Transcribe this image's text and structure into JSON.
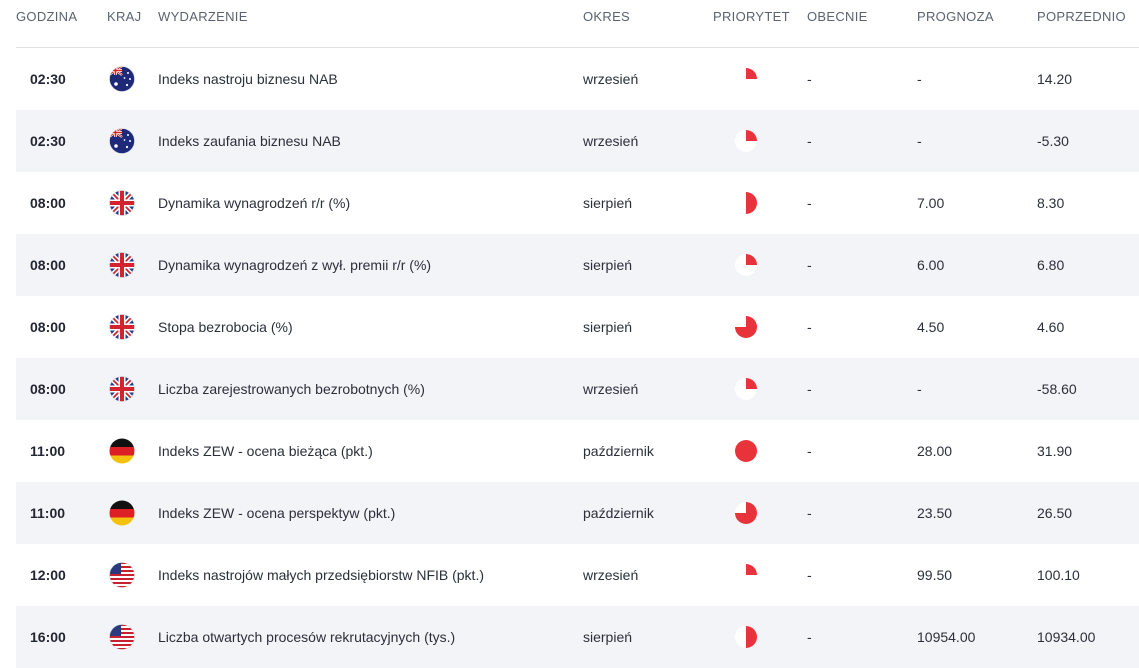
{
  "header": {
    "time": "GODZINA",
    "country": "KRAJ",
    "event": "WYDARZENIE",
    "period": "OKRES",
    "priority": "PRIORYTET",
    "actual": "OBECNIE",
    "forecast": "PROGNOZA",
    "previous": "POPRZEDNIO"
  },
  "colors": {
    "priority": "#e8333a",
    "alt_row": "#f3f4f7"
  },
  "rows": [
    {
      "time": "02:30",
      "flag": "australia-flag-icon",
      "event": "Indeks nastroju biznesu NAB",
      "period": "wrzesień",
      "priority": 0.25,
      "actual": "-",
      "forecast": "-",
      "previous": "14.20"
    },
    {
      "time": "02:30",
      "flag": "australia-flag-icon",
      "event": "Indeks zaufania biznesu NAB",
      "period": "wrzesień",
      "priority": 0.25,
      "actual": "-",
      "forecast": "-",
      "previous": "-5.30"
    },
    {
      "time": "08:00",
      "flag": "uk-flag-icon",
      "event": "Dynamika wynagrodzeń r/r (%)",
      "period": "sierpień",
      "priority": 0.5,
      "actual": "-",
      "forecast": "7.00",
      "previous": "8.30"
    },
    {
      "time": "08:00",
      "flag": "uk-flag-icon",
      "event": "Dynamika wynagrodzeń z wył. premii r/r (%)",
      "period": "sierpień",
      "priority": 0.25,
      "actual": "-",
      "forecast": "6.00",
      "previous": "6.80"
    },
    {
      "time": "08:00",
      "flag": "uk-flag-icon",
      "event": "Stopa bezrobocia (%)",
      "period": "sierpień",
      "priority": 0.75,
      "actual": "-",
      "forecast": "4.50",
      "previous": "4.60"
    },
    {
      "time": "08:00",
      "flag": "uk-flag-icon",
      "event": "Liczba zarejestrowanych bezrobotnych (%)",
      "period": "wrzesień",
      "priority": 0.25,
      "actual": "-",
      "forecast": "-",
      "previous": "-58.60"
    },
    {
      "time": "11:00",
      "flag": "germany-flag-icon",
      "event": "Indeks ZEW - ocena bieżąca (pkt.)",
      "period": "październik",
      "priority": 1.0,
      "actual": "-",
      "forecast": "28.00",
      "previous": "31.90"
    },
    {
      "time": "11:00",
      "flag": "germany-flag-icon",
      "event": "Indeks ZEW - ocena perspektyw (pkt.)",
      "period": "październik",
      "priority": 0.75,
      "actual": "-",
      "forecast": "23.50",
      "previous": "26.50"
    },
    {
      "time": "12:00",
      "flag": "usa-flag-icon",
      "event": "Indeks nastrojów małych przedsiębiorstw NFIB (pkt.)",
      "period": "wrzesień",
      "priority": 0.25,
      "actual": "-",
      "forecast": "99.50",
      "previous": "100.10"
    },
    {
      "time": "16:00",
      "flag": "usa-flag-icon",
      "event": "Liczba otwartych procesów rekrutacyjnych (tys.)",
      "period": "sierpień",
      "priority": 0.5,
      "actual": "-",
      "forecast": "10954.00",
      "previous": "10934.00"
    }
  ]
}
